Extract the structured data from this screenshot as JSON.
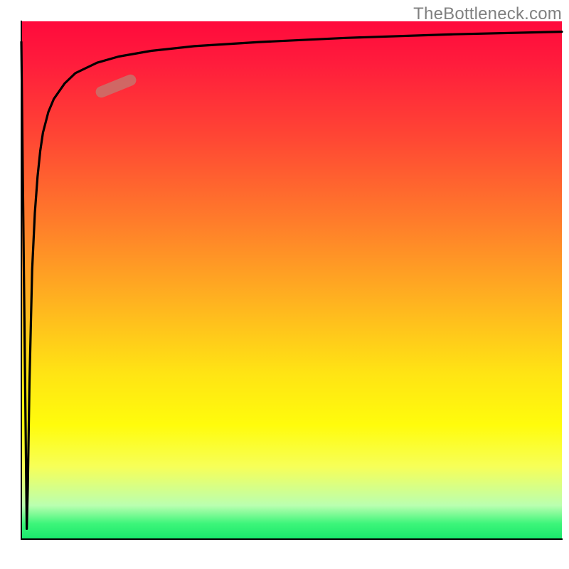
{
  "watermark": "TheBottleneck.com",
  "colors": {
    "gradient_top": "#ff0a3c",
    "gradient_mid1": "#ff7a2b",
    "gradient_mid2": "#ffe414",
    "gradient_bottom": "#18e86c",
    "curve": "#000000",
    "highlight_pill": "#c6756e",
    "axis": "#000000",
    "watermark_text": "#808080"
  },
  "chart_data": {
    "type": "line",
    "title": "",
    "xlabel": "",
    "ylabel": "",
    "xlim": [
      0,
      100
    ],
    "ylim": [
      0,
      100
    ],
    "grid": false,
    "legend": false,
    "series": [
      {
        "name": "bottleneck-curve",
        "description": "Bottleneck percentage vs. parameter. Sharp spike down to 0 at the very start of the x axis, then a steep rise following roughly a logarithmic saturation toward ~100.",
        "x": [
          0.0,
          1.0,
          1.2,
          1.5,
          2.0,
          2.5,
          3.0,
          3.5,
          4.0,
          5.0,
          6.0,
          8.0,
          10.0,
          14.0,
          18.0,
          24.0,
          32.0,
          44.0,
          60.0,
          80.0,
          100.0
        ],
        "y": [
          96.0,
          2.0,
          10.0,
          30.0,
          52.0,
          63.0,
          70.0,
          75.0,
          78.5,
          82.5,
          85.0,
          88.0,
          90.0,
          92.0,
          93.2,
          94.3,
          95.2,
          96.0,
          96.8,
          97.5,
          98.0
        ]
      }
    ],
    "annotations": [
      {
        "name": "highlight-pill",
        "description": "small salmon rounded-rect marker along the curve",
        "x_center": 17.5,
        "y_center": 87.5,
        "color": "#c6756e"
      }
    ],
    "background_gradient": {
      "orientation": "vertical",
      "stops": [
        {
          "pos": 0.0,
          "color": "#ff0a3c"
        },
        {
          "pos": 0.38,
          "color": "#ff7a2b"
        },
        {
          "pos": 0.7,
          "color": "#ffe414"
        },
        {
          "pos": 0.94,
          "color": "#baffb0"
        },
        {
          "pos": 1.0,
          "color": "#18e86c"
        }
      ]
    }
  }
}
